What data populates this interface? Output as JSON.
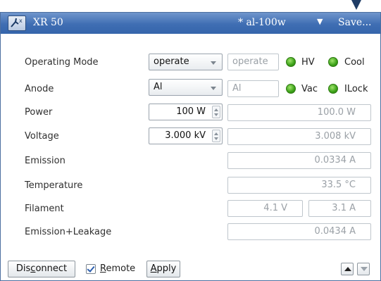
{
  "titlebar": {
    "app_title": "XR 50",
    "config_name": "* al-100w",
    "dropdown_glyph": "▼",
    "save_label": "Save..."
  },
  "rows": {
    "operating_mode": {
      "label": "Operating Mode",
      "selected": "operate",
      "readback": "operate",
      "indicators": [
        {
          "label": "HV",
          "state": "on",
          "color": "#3aa017"
        },
        {
          "label": "Cool",
          "state": "on",
          "color": "#3aa017"
        }
      ]
    },
    "anode": {
      "label": "Anode",
      "selected": "Al",
      "readback": "Al",
      "indicators": [
        {
          "label": "Vac",
          "state": "on",
          "color": "#3aa017"
        },
        {
          "label": "ILock",
          "state": "on",
          "color": "#3aa017"
        }
      ]
    },
    "power": {
      "label": "Power",
      "setpoint": "100 W",
      "readback": "100.0 W"
    },
    "voltage": {
      "label": "Voltage",
      "setpoint": "3.000 kV",
      "readback": "3.008 kV"
    },
    "emission": {
      "label": "Emission",
      "readback": "0.0334 A"
    },
    "temperature": {
      "label": "Temperature",
      "readback": "33.5 °C"
    },
    "filament": {
      "label": "Filament",
      "voltage": "4.1 V",
      "current": "3.1 A"
    },
    "emission_leakage": {
      "label": "Emission+Leakage",
      "readback": "0.0434 A"
    }
  },
  "footer": {
    "disconnect_pre": "Dis",
    "disconnect_mnemonic": "c",
    "disconnect_post": "onnect",
    "remote_checked": true,
    "remote_mnemonic": "R",
    "remote_post": "emote",
    "apply_mnemonic": "A",
    "apply_post": "pply"
  },
  "icons": [
    "app-icon",
    "dropdown-arrow-icon",
    "pointer-arrow-icon",
    "spinner-icon",
    "scroll-up-icon",
    "scroll-down-icon"
  ]
}
